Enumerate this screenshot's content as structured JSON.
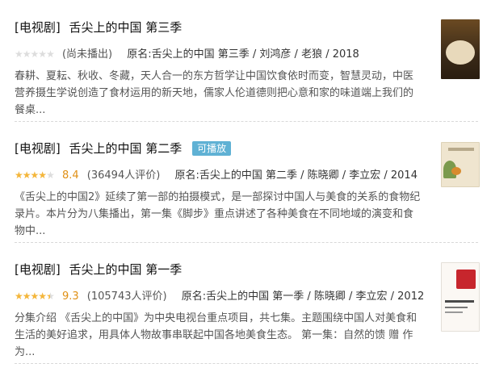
{
  "items": [
    {
      "category": "[电视剧]",
      "title": "舌尖上的中国 第三季",
      "badge": "",
      "stars": 0,
      "rating": "",
      "votes": "(尚未播出)",
      "original": "原名:舌尖上的中国 第三季 / 刘鸿彦 / 老狼 / 2018",
      "description": "春耕、夏耘、秋收、冬藏，天人合一的东方哲学让中国饮食依时而变，智慧灵动，中医营养摄生学说创造了食材运用的新天地，儒家人伦道德则把心意和家的味道端上我们的餐桌...",
      "poster": "poster-thumbnail"
    },
    {
      "category": "[电视剧]",
      "title": "舌尖上的中国 第二季",
      "badge": "可播放",
      "stars": 4,
      "rating": "8.4",
      "votes": "(36494人评价)",
      "original": "原名:舌尖上的中国 第二季 / 陈晓卿 / 李立宏 / 2014",
      "description": "《舌尖上的中国2》延续了第一部的拍摄模式，是一部探讨中国人与美食的关系的食物纪录片。本片分为八集播出，第一集《脚步》重点讲述了各种美食在不同地域的演变和食物中...",
      "poster": "poster-thumbnail"
    },
    {
      "category": "[电视剧]",
      "title": "舌尖上的中国 第一季",
      "badge": "",
      "stars": 4.5,
      "rating": "9.3",
      "votes": "(105743人评价)",
      "original": "原名:舌尖上的中国 第一季 / 陈晓卿 / 李立宏 / 2012",
      "description": "分集介绍 《舌尖上的中国》为中央电视台重点项目，共七集。主题围绕中国人对美食和生活的美好追求，用具体人物故事串联起中国各地美食生态。 第一集：自然的馈 赠 作为...",
      "poster": "poster-thumbnail"
    }
  ],
  "colors": {
    "badge_bg": "#5fb1d4",
    "star": "#f4b63b",
    "star_off": "#dddddd",
    "rating": "#e09015"
  }
}
